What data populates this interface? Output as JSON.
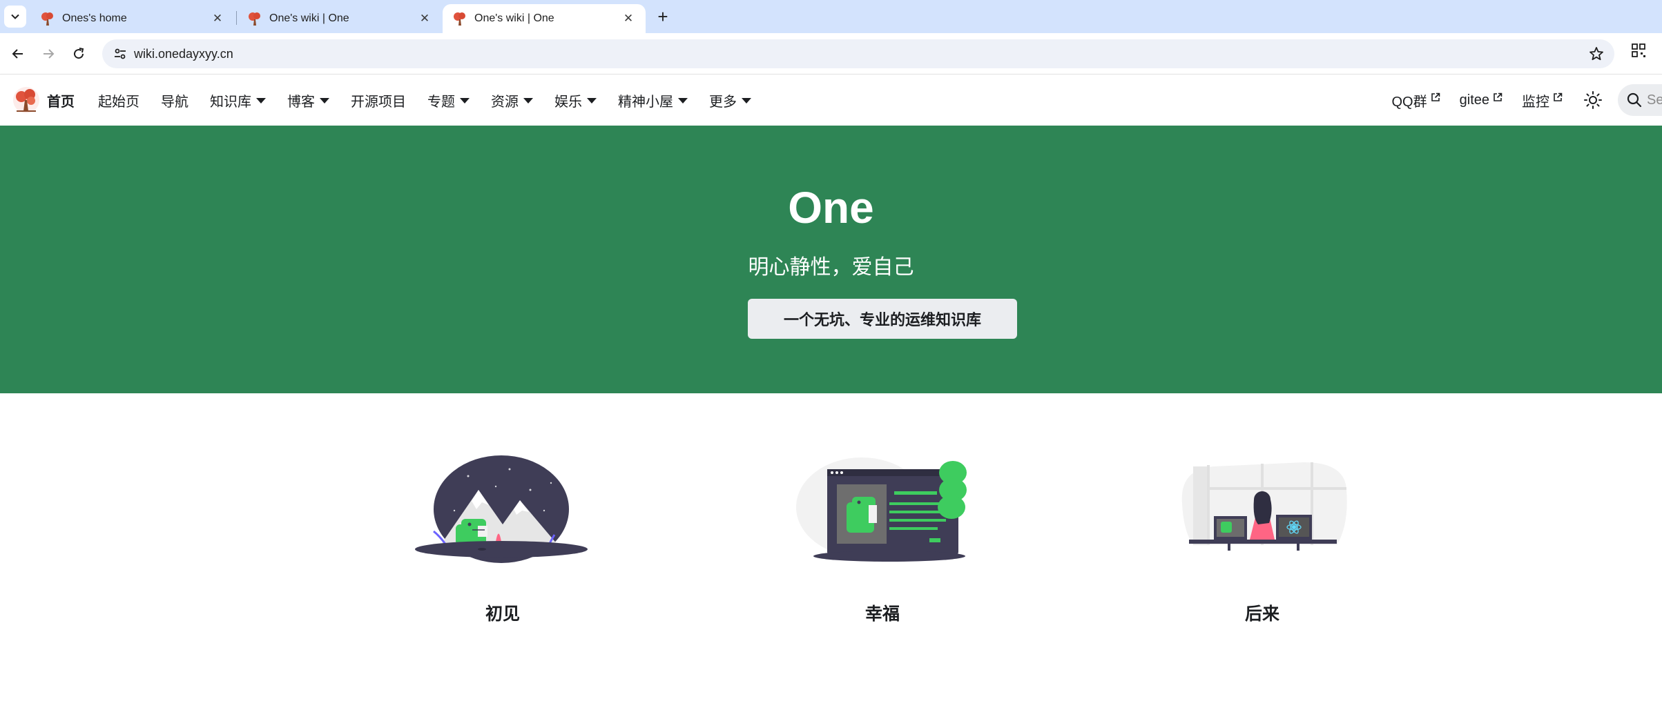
{
  "browser": {
    "tabs": [
      {
        "title": "Ones's home",
        "active": false
      },
      {
        "title": "One's wiki | One",
        "active": false
      },
      {
        "title": "One's wiki | One",
        "active": true
      }
    ],
    "url": "wiki.onedayxyy.cn"
  },
  "navbar": {
    "brand": "首页",
    "items": [
      {
        "label": "起始页",
        "dropdown": false
      },
      {
        "label": "导航",
        "dropdown": false
      },
      {
        "label": "知识库",
        "dropdown": true
      },
      {
        "label": "博客",
        "dropdown": true
      },
      {
        "label": "开源项目",
        "dropdown": false
      },
      {
        "label": "专题",
        "dropdown": true
      },
      {
        "label": "资源",
        "dropdown": true
      },
      {
        "label": "娱乐",
        "dropdown": true
      },
      {
        "label": "精神小屋",
        "dropdown": true
      },
      {
        "label": "更多",
        "dropdown": true
      }
    ],
    "external_links": [
      "QQ群",
      "gitee",
      "监控"
    ],
    "search_placeholder": "Se"
  },
  "hero": {
    "title": "One",
    "subtitle": "明心静性，爱自己",
    "button_label": "一个无坑、专业的运维知识库"
  },
  "features": [
    {
      "title": "初见",
      "illustration": "mountain-dino-illustration"
    },
    {
      "title": "幸福",
      "illustration": "screen-dino-illustration"
    },
    {
      "title": "后来",
      "illustration": "developer-desk-illustration"
    }
  ],
  "colors": {
    "primary": "#2e8555",
    "tabstrip": "#d3e3fd",
    "dino_green": "#3ecc5f",
    "illustration_dark": "#3f3d56"
  }
}
